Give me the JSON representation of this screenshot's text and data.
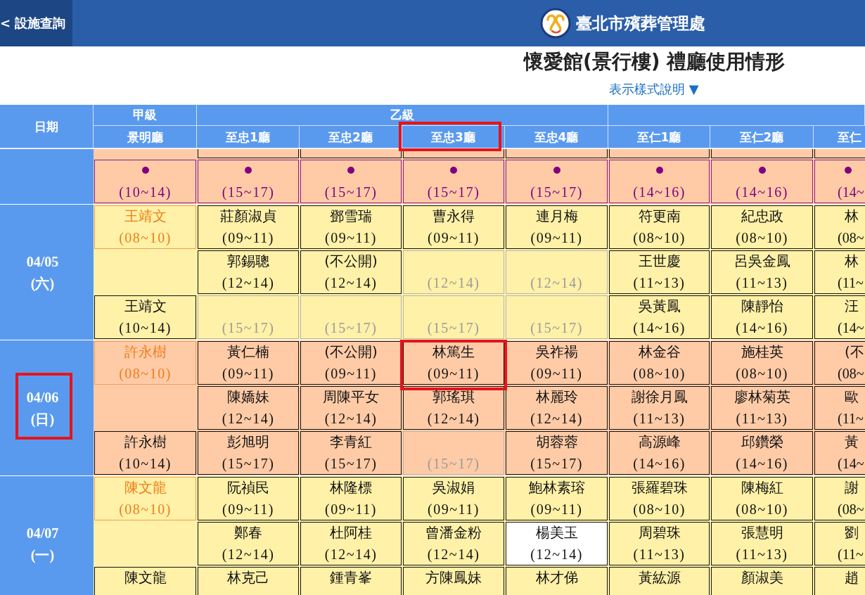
{
  "top_bar": {
    "back_button": "< 設施查詢",
    "agency_name": "臺北市殯葬管理處"
  },
  "heading": {
    "title": "懷愛館(景行樓) 禮廳使用情形",
    "legend_link": "表示樣式說明 ▼"
  },
  "table": {
    "date_heading": "日期",
    "groups": [
      {
        "label": "甲級",
        "halls": [
          {
            "name": "景明廳",
            "highlighted": false
          }
        ]
      },
      {
        "label": "乙級",
        "halls": [
          {
            "name": "至忠1廳",
            "highlighted": false
          },
          {
            "name": "至忠2廳",
            "highlighted": false
          },
          {
            "name": "至忠3廳",
            "highlighted": true
          },
          {
            "name": "至忠4廳",
            "highlighted": false
          }
        ]
      },
      {
        "halls": [
          {
            "name": "至仁1廳",
            "highlighted": false
          },
          {
            "name": "至仁2廳",
            "highlighted": false
          },
          {
            "name": "至仁",
            "highlighted": false
          }
        ]
      }
    ],
    "days": [
      {
        "highlighted": false,
        "rows": [
          {
            "kind": "top_cut",
            "cells": [
              {
                "kind": "gap"
              },
              {
                "kind": "booked",
                "highlighted": false
              },
              {
                "kind": "booked",
                "highlighted": false
              },
              {
                "kind": "booked",
                "highlighted": false
              },
              {
                "kind": "booked",
                "highlighted": false
              },
              {
                "kind": "booked",
                "highlighted": false
              },
              {
                "kind": "booked",
                "highlighted": false
              },
              {
                "kind": "booked",
                "highlighted": false
              }
            ]
          },
          {
            "kind": "full",
            "cells": [
              {
                "kind": "masked",
                "time": "(10~14)",
                "highlighted": false
              },
              {
                "kind": "masked",
                "time": "(15~17)",
                "highlighted": false
              },
              {
                "kind": "masked",
                "time": "(15~17)",
                "highlighted": false
              },
              {
                "kind": "masked",
                "time": "(15~17)",
                "highlighted": false
              },
              {
                "kind": "masked",
                "time": "(15~17)",
                "highlighted": false
              },
              {
                "kind": "masked",
                "time": "(14~16)",
                "highlighted": false
              },
              {
                "kind": "masked",
                "time": "(14~16)",
                "highlighted": false
              },
              {
                "kind": "masked",
                "time": "(14~",
                "highlighted": false
              }
            ]
          }
        ]
      },
      {
        "date": "04/05",
        "weekday": "(六)",
        "highlighted": false,
        "rows": [
          {
            "kind": "full",
            "cells": [
              {
                "kind": "featured",
                "name": "王靖文",
                "time": "(08~10)",
                "highlighted": false
              },
              {
                "kind": "booked",
                "name": "莊顏淑貞",
                "time": "(09~11)",
                "highlighted": false
              },
              {
                "kind": "booked",
                "name": "鄧雪瑞",
                "time": "(09~11)",
                "highlighted": false
              },
              {
                "kind": "booked",
                "name": "曹永得",
                "time": "(09~11)",
                "highlighted": false
              },
              {
                "kind": "booked",
                "name": "連月梅",
                "time": "(09~11)",
                "highlighted": false
              },
              {
                "kind": "booked",
                "name": "符更南",
                "time": "(08~10)",
                "highlighted": false
              },
              {
                "kind": "booked",
                "name": "紀忠政",
                "time": "(08~10)",
                "highlighted": false
              },
              {
                "kind": "booked",
                "name": "林",
                "time": "(08~",
                "highlighted": false
              }
            ]
          },
          {
            "kind": "full",
            "cells": [
              {
                "kind": "gap"
              },
              {
                "kind": "booked",
                "name": "郭錫聰",
                "time": "(12~14)",
                "highlighted": false
              },
              {
                "kind": "booked",
                "name": "(不公開)",
                "time": "(12~14)",
                "highlighted": false
              },
              {
                "kind": "vacant",
                "time": "(12~14)",
                "highlighted": false
              },
              {
                "kind": "vacant",
                "time": "(12~14)",
                "highlighted": false
              },
              {
                "kind": "booked",
                "name": "王世慶",
                "time": "(11~13)",
                "highlighted": false
              },
              {
                "kind": "booked",
                "name": "呂吳金鳳",
                "time": "(11~13)",
                "highlighted": false
              },
              {
                "kind": "booked",
                "name": "林",
                "time": "(11~",
                "highlighted": false
              }
            ]
          },
          {
            "kind": "full",
            "cells": [
              {
                "kind": "booked",
                "name": "王靖文",
                "time": "(10~14)",
                "highlighted": false
              },
              {
                "kind": "vacant",
                "time": "(15~17)",
                "highlighted": false
              },
              {
                "kind": "vacant",
                "time": "(15~17)",
                "highlighted": false
              },
              {
                "kind": "vacant",
                "time": "(15~17)",
                "highlighted": false
              },
              {
                "kind": "vacant",
                "time": "(15~17)",
                "highlighted": false
              },
              {
                "kind": "booked",
                "name": "吳黃鳳",
                "time": "(14~16)",
                "highlighted": false
              },
              {
                "kind": "booked",
                "name": "陳靜怡",
                "time": "(14~16)",
                "highlighted": false
              },
              {
                "kind": "booked",
                "name": "汪",
                "time": "(14~",
                "highlighted": false
              }
            ]
          }
        ]
      },
      {
        "date": "04/06",
        "weekday": "(日)",
        "highlighted": true,
        "rows": [
          {
            "kind": "full",
            "cells": [
              {
                "kind": "featured",
                "name": "許永樹",
                "time": "(08~10)",
                "highlighted": false
              },
              {
                "kind": "booked",
                "name": "黃仁楠",
                "time": "(09~11)",
                "highlighted": false
              },
              {
                "kind": "booked",
                "name": "(不公開)",
                "time": "(09~11)",
                "highlighted": false
              },
              {
                "kind": "booked",
                "name": "林篤生",
                "time": "(09~11)",
                "highlighted": true
              },
              {
                "kind": "booked",
                "name": "吳祚禓",
                "time": "(09~11)",
                "highlighted": false
              },
              {
                "kind": "booked",
                "name": "林金谷",
                "time": "(08~10)",
                "highlighted": false
              },
              {
                "kind": "booked",
                "name": "施桂英",
                "time": "(08~10)",
                "highlighted": false
              },
              {
                "kind": "booked",
                "name": "(不",
                "time": "(08~",
                "highlighted": false
              }
            ]
          },
          {
            "kind": "full",
            "cells": [
              {
                "kind": "gap"
              },
              {
                "kind": "booked",
                "name": "陳嬌妹",
                "time": "(12~14)",
                "highlighted": false
              },
              {
                "kind": "booked",
                "name": "周陳平女",
                "time": "(12~14)",
                "highlighted": false
              },
              {
                "kind": "booked",
                "name": "郭瑤琪",
                "time": "(12~14)",
                "highlighted": false
              },
              {
                "kind": "booked",
                "name": "林麗玲",
                "time": "(12~14)",
                "highlighted": false
              },
              {
                "kind": "booked",
                "name": "謝徐月鳳",
                "time": "(11~13)",
                "highlighted": false
              },
              {
                "kind": "booked",
                "name": "廖林菊英",
                "time": "(11~13)",
                "highlighted": false
              },
              {
                "kind": "booked",
                "name": "歐",
                "time": "(11~",
                "highlighted": false
              }
            ]
          },
          {
            "kind": "full",
            "cells": [
              {
                "kind": "booked",
                "name": "許永樹",
                "time": "(10~14)",
                "highlighted": false
              },
              {
                "kind": "booked",
                "name": "彭旭明",
                "time": "(15~17)",
                "highlighted": false
              },
              {
                "kind": "booked",
                "name": "李青紅",
                "time": "(15~17)",
                "highlighted": false
              },
              {
                "kind": "vacant",
                "time": "(15~17)",
                "highlighted": false
              },
              {
                "kind": "booked",
                "name": "胡蓉蓉",
                "time": "(15~17)",
                "highlighted": false
              },
              {
                "kind": "booked",
                "name": "高源峰",
                "time": "(14~16)",
                "highlighted": false
              },
              {
                "kind": "booked",
                "name": "邱鑽榮",
                "time": "(14~16)",
                "highlighted": false
              },
              {
                "kind": "booked",
                "name": "黃",
                "time": "(14~",
                "highlighted": false
              }
            ]
          }
        ]
      },
      {
        "date": "04/07",
        "weekday": "(一)",
        "highlighted": false,
        "rows": [
          {
            "kind": "full",
            "cells": [
              {
                "kind": "featured",
                "name": "陳文龍",
                "time": "(08~10)",
                "highlighted": false
              },
              {
                "kind": "booked",
                "name": "阮禎民",
                "time": "(09~11)",
                "highlighted": false
              },
              {
                "kind": "booked",
                "name": "林隆標",
                "time": "(09~11)",
                "highlighted": false
              },
              {
                "kind": "booked",
                "name": "吳淑娟",
                "time": "(09~11)",
                "highlighted": false
              },
              {
                "kind": "booked",
                "name": "鮑林素瑢",
                "time": "(09~11)",
                "highlighted": false
              },
              {
                "kind": "booked",
                "name": "張羅碧珠",
                "time": "(08~10)",
                "highlighted": false
              },
              {
                "kind": "booked",
                "name": "陳梅紅",
                "time": "(08~10)",
                "highlighted": false
              },
              {
                "kind": "booked",
                "name": "謝",
                "time": "(08~",
                "highlighted": false
              }
            ]
          },
          {
            "kind": "full",
            "cells": [
              {
                "kind": "gap"
              },
              {
                "kind": "booked",
                "name": "鄭春",
                "time": "(12~14)",
                "highlighted": false
              },
              {
                "kind": "booked",
                "name": "杜阿桂",
                "time": "(12~14)",
                "highlighted": false
              },
              {
                "kind": "booked",
                "name": "曾潘金粉",
                "time": "(12~14)",
                "highlighted": false
              },
              {
                "kind": "outside",
                "name": "楊美玉",
                "time": "(12~14)",
                "highlighted": false
              },
              {
                "kind": "booked",
                "name": "周碧珠",
                "time": "(11~13)",
                "highlighted": false
              },
              {
                "kind": "booked",
                "name": "張慧明",
                "time": "(11~13)",
                "highlighted": false
              },
              {
                "kind": "booked",
                "name": "劉",
                "time": "(11~",
                "highlighted": false
              }
            ]
          },
          {
            "kind": "bottom_cut",
            "cells": [
              {
                "kind": "booked",
                "name": "陳文龍",
                "highlighted": false
              },
              {
                "kind": "booked",
                "name": "林克己",
                "highlighted": false
              },
              {
                "kind": "booked",
                "name": "鍾青峯",
                "highlighted": false
              },
              {
                "kind": "booked",
                "name": "方陳鳳妹",
                "highlighted": false
              },
              {
                "kind": "booked",
                "name": "林才俤",
                "highlighted": false
              },
              {
                "kind": "booked",
                "name": "黃紘源",
                "highlighted": false
              },
              {
                "kind": "booked",
                "name": "顏淑美",
                "highlighted": false
              },
              {
                "kind": "booked",
                "name": "趙",
                "highlighted": false
              }
            ]
          }
        ]
      }
    ]
  }
}
